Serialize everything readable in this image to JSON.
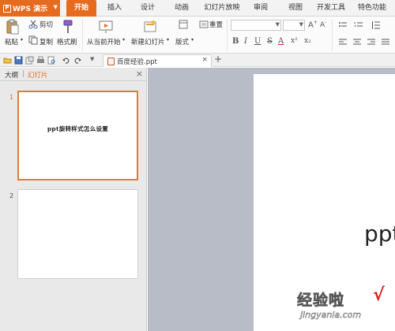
{
  "app": {
    "name": "WPS 演示",
    "accent": "#e76b1f"
  },
  "tabs": [
    "开始",
    "插入",
    "设计",
    "动画",
    "幻灯片放映",
    "审阅",
    "视图",
    "开发工具",
    "特色功能"
  ],
  "ribbon": {
    "paste_label": "粘贴",
    "cut_label": "剪切",
    "copy_label": "复制",
    "format_painter_label": "格式刷",
    "play_from_current_label": "从当前开始",
    "new_slide_label": "新建幻灯片",
    "layout_label": "版式",
    "reset_label": "重置",
    "format_buttons": [
      "B",
      "I",
      "U",
      "S",
      "A",
      "x²",
      "x₂"
    ]
  },
  "document": {
    "tab_title": "百度经验.ppt",
    "close_symbol": "×",
    "new_tab_symbol": "+"
  },
  "left_pane": {
    "tab_outline": "大纲",
    "tab_divider": "|",
    "tab_slides": "幻灯片",
    "close_symbol": "×",
    "slides": [
      {
        "number": "1",
        "text": "ppt旋转样式怎么设置"
      },
      {
        "number": "2",
        "text": ""
      }
    ]
  },
  "canvas": {
    "slide_text": "ppt"
  },
  "watermark": {
    "text": "经验啦",
    "check": "√",
    "url": "jingyanla.com"
  }
}
